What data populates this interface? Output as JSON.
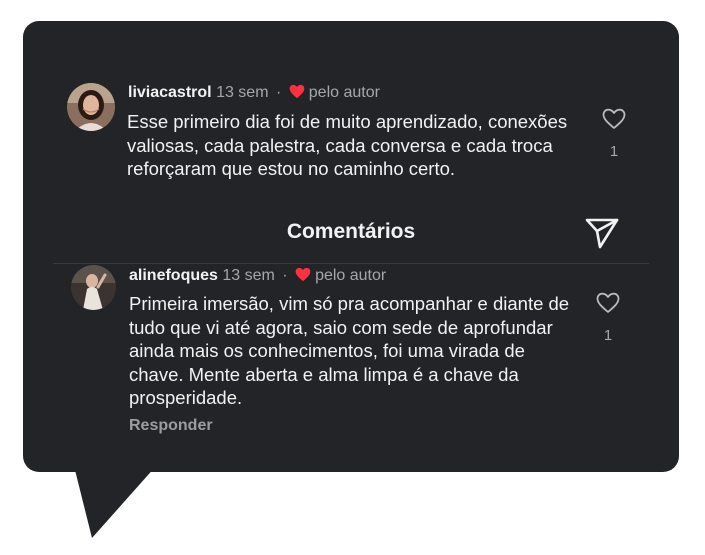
{
  "header": {
    "title": "Comentários"
  },
  "comments": [
    {
      "username": "liviacastrol",
      "time": "13 sem",
      "separator": "·",
      "author_like": "pelo autor",
      "text": "Esse primeiro dia foi de muito aprendizado, conexões valiosas, cada palestra, cada conversa e cada troca reforçaram que estou no caminho certo.",
      "likes": "1"
    },
    {
      "username": "alinefoques",
      "time": "13 sem",
      "separator": "·",
      "author_like": "pelo autor",
      "text": "Primeira imersão, vim só pra acompanhar e diante de tudo que vi até agora, saio com sede de aprofundar ainda mais os conhecimentos, foi uma virada de chave. Mente aberta e alma limpa é a chave da prosperidade.",
      "likes": "1",
      "reply_label": "Responder"
    }
  ],
  "icons": {
    "author_heart": "heart-filled-icon",
    "like": "heart-outline-icon",
    "share": "paper-plane-icon"
  },
  "colors": {
    "background": "#232427",
    "text": "#f2f2f3",
    "muted": "#a6a7ab",
    "heart": "#ff3040"
  }
}
